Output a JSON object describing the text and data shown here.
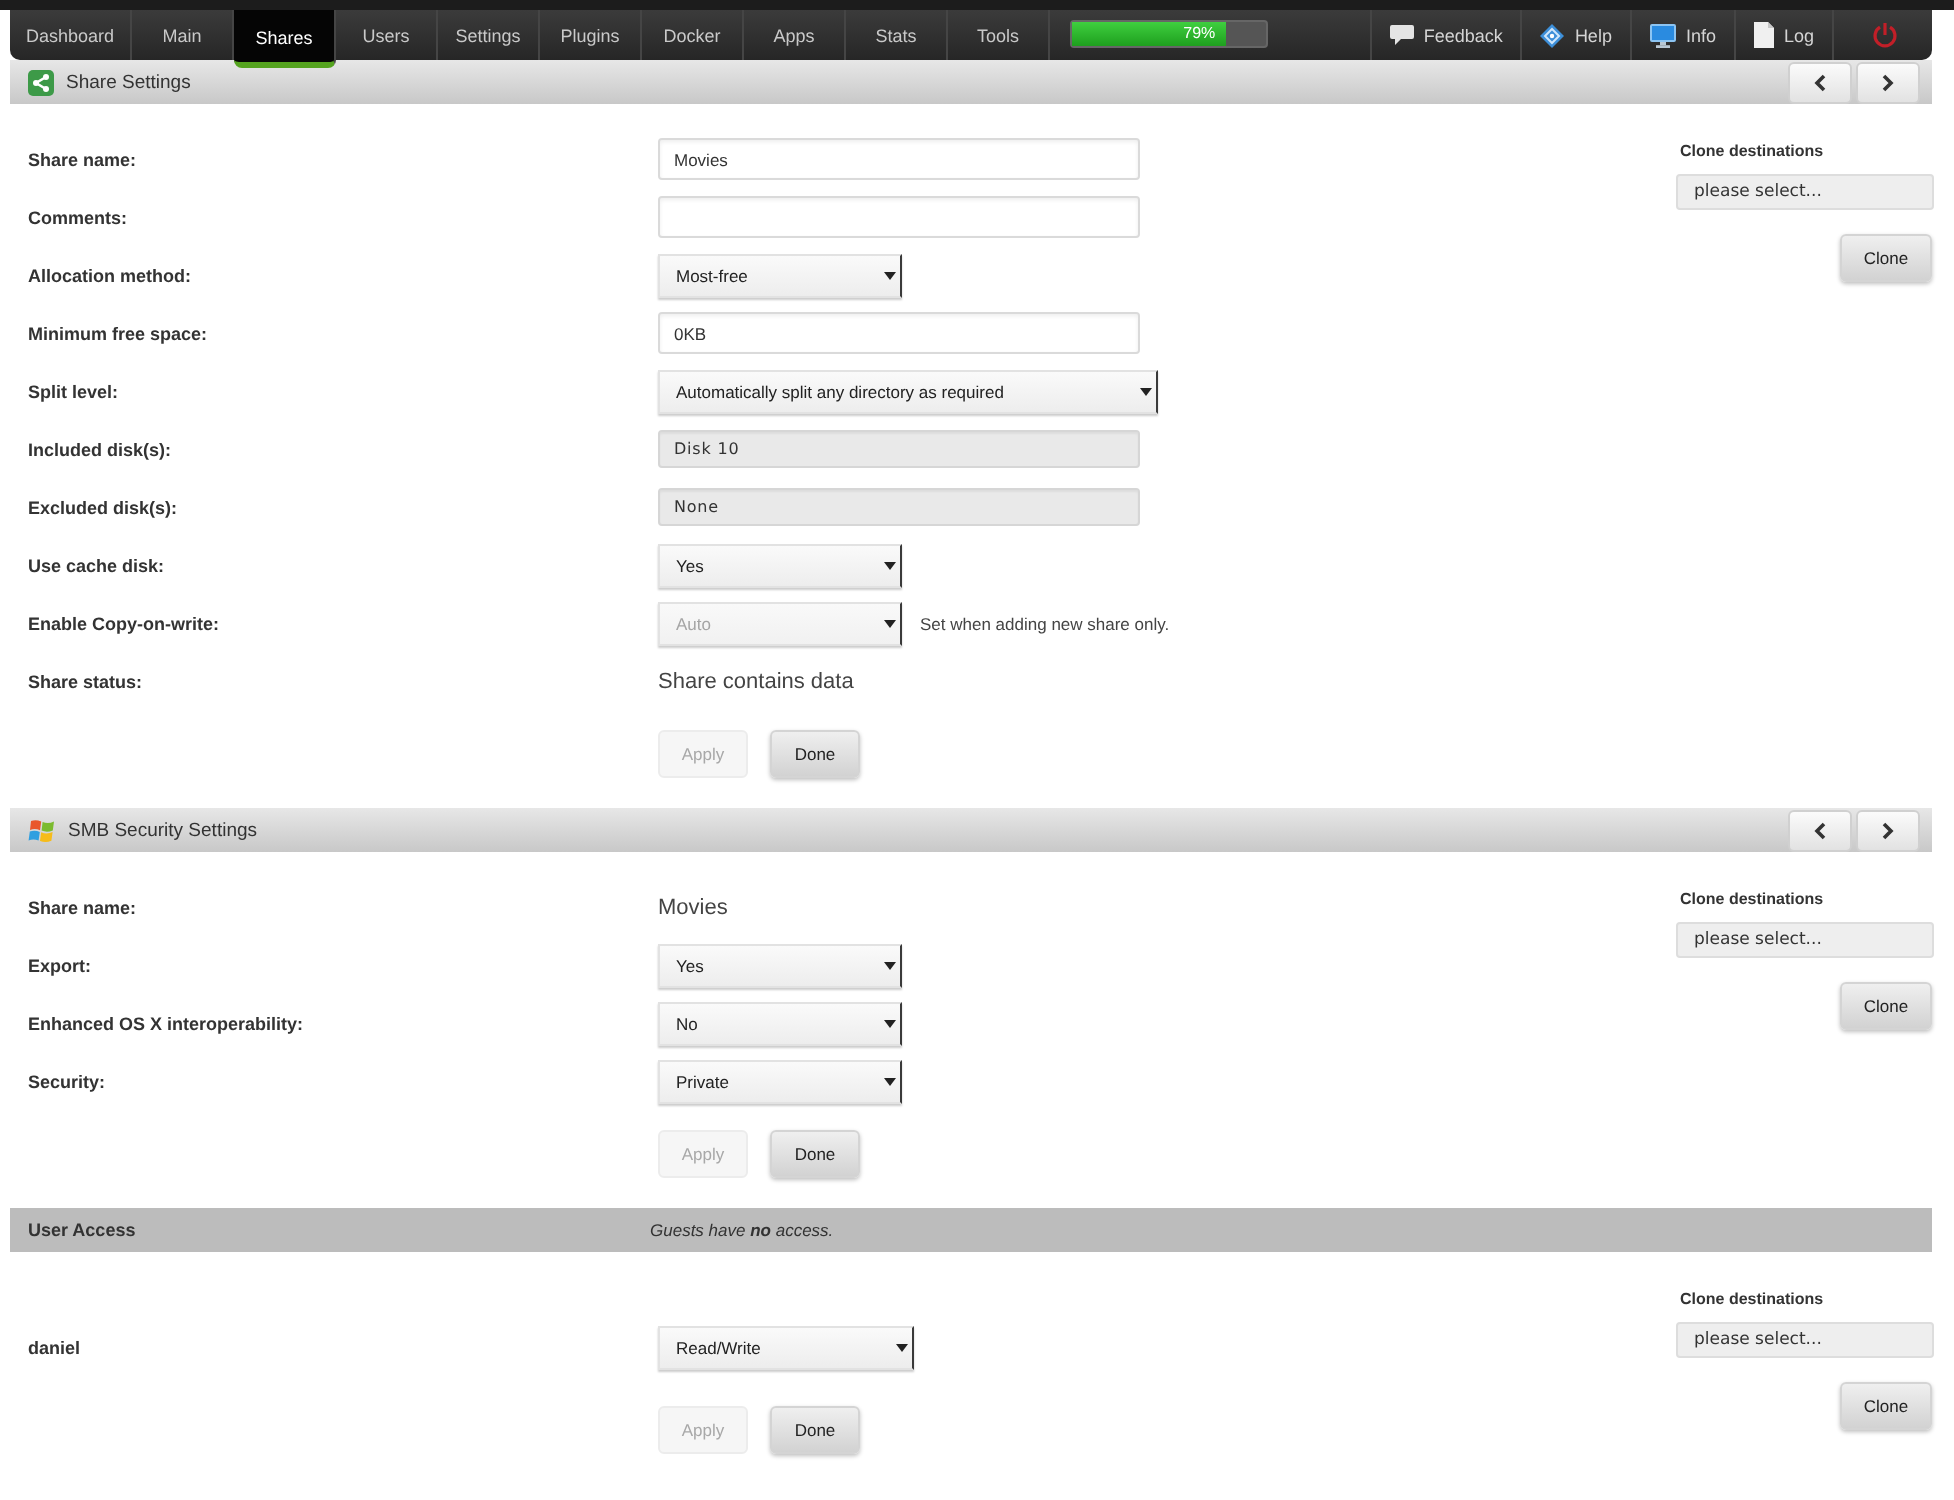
{
  "nav": {
    "tabs": [
      {
        "label": "Dashboard",
        "selected": false
      },
      {
        "label": "Main",
        "selected": false
      },
      {
        "label": "Shares",
        "selected": true
      },
      {
        "label": "Users",
        "selected": false
      },
      {
        "label": "Settings",
        "selected": false
      },
      {
        "label": "Plugins",
        "selected": false
      },
      {
        "label": "Docker",
        "selected": false
      },
      {
        "label": "Apps",
        "selected": false
      },
      {
        "label": "Stats",
        "selected": false
      },
      {
        "label": "Tools",
        "selected": false
      }
    ],
    "usage": {
      "level": 0.79,
      "reading": "79%"
    },
    "links": [
      {
        "kind": "feedback",
        "label": "Feedback"
      },
      {
        "kind": "help",
        "label": "Help"
      },
      {
        "kind": "info",
        "label": "Info"
      },
      {
        "kind": "log",
        "label": "Log"
      }
    ]
  },
  "sections": [
    {
      "kind": "share",
      "title": "Share Settings",
      "rows": [
        {
          "label": "Share name:",
          "control": {
            "kind": "text",
            "value": "Movies"
          }
        },
        {
          "label": "Comments:",
          "control": {
            "kind": "text"
          }
        },
        {
          "label": "Allocation method:",
          "control": {
            "kind": "select",
            "value": "Most-free",
            "disabled": false
          }
        },
        {
          "label": "Minimum free space:",
          "control": {
            "kind": "text",
            "value": "0KB"
          }
        },
        {
          "label": "Split level:",
          "control": {
            "kind": "select",
            "value": "Automatically split any directory as required",
            "disabled": false
          }
        },
        {
          "label": "Included disk(s):",
          "control": {
            "kind": "list",
            "value": "Disk 10"
          }
        },
        {
          "label": "Excluded disk(s):",
          "control": {
            "kind": "list",
            "value": "None"
          }
        },
        {
          "label": "Use cache disk:",
          "control": {
            "kind": "select",
            "value": "Yes",
            "disabled": false
          }
        },
        {
          "label": "Enable Copy-on-write:",
          "control": {
            "kind": "select",
            "value": "Auto",
            "disabled": true
          },
          "note": "Set when adding new share only."
        },
        {
          "label": "Share status:",
          "control": {
            "kind": "static",
            "value": "Share contains data"
          }
        }
      ],
      "buttons": [
        {
          "label": "Apply",
          "disabled": true
        },
        {
          "label": "Done",
          "disabled": false
        }
      ],
      "clone": {
        "heading": "Clone destinations",
        "value": "please select...",
        "button": "Clone"
      }
    },
    {
      "kind": "smb",
      "title": "SMB Security Settings",
      "rows": [
        {
          "label": "Share name:",
          "control": {
            "kind": "static",
            "value": "Movies"
          }
        },
        {
          "label": "Export:",
          "control": {
            "kind": "select",
            "value": "Yes",
            "disabled": false
          }
        },
        {
          "label": "Enhanced OS X interoperability:",
          "control": {
            "kind": "select",
            "value": "No",
            "disabled": false
          }
        },
        {
          "label": "Security:",
          "control": {
            "kind": "select",
            "value": "Private",
            "disabled": false
          }
        }
      ],
      "buttons": [
        {
          "label": "Apply",
          "disabled": true
        },
        {
          "label": "Done",
          "disabled": false
        }
      ],
      "clone": {
        "heading": "Clone destinations",
        "value": "please select...",
        "button": "Clone"
      }
    },
    {
      "kind": "access",
      "title": "User Access",
      "note": "Guests have **no** access.",
      "rows": [
        {
          "label": "daniel",
          "control": {
            "kind": "select",
            "value": "Read/Write",
            "disabled": false
          }
        }
      ],
      "buttons": [
        {
          "label": "Apply",
          "disabled": true
        },
        {
          "label": "Done",
          "disabled": false
        }
      ],
      "clone": {
        "heading": "Clone destinations",
        "value": "please select...",
        "button": "Clone"
      }
    }
  ]
}
